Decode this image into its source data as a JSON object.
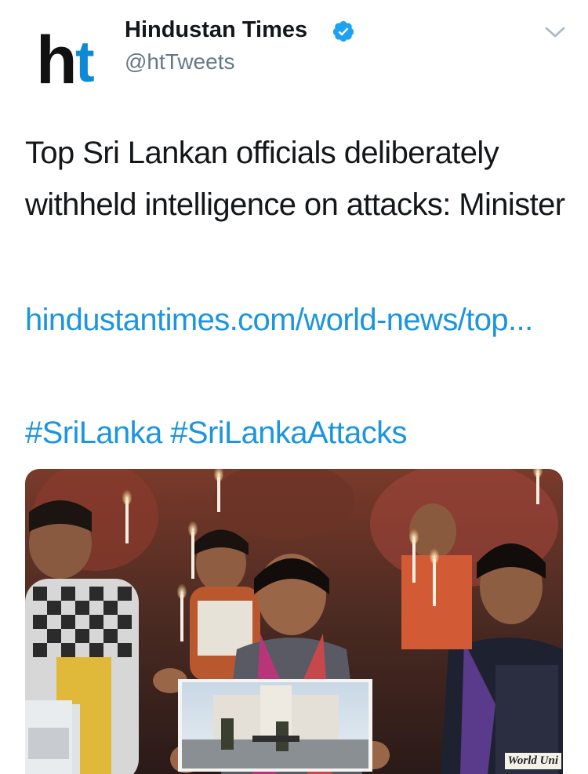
{
  "account": {
    "display_name": "Hindustan Times",
    "handle": "@htTweets",
    "verified": true,
    "avatar_logo": {
      "letter_h": "h",
      "letter_t": "t",
      "h_color": "#111111",
      "t_color": "#0c8ad6"
    }
  },
  "tweet": {
    "text": "Top Sri Lankan officials deliberately withheld intelligence on attacks: Minister",
    "link_text": "hindustantimes.com/world-news/top...",
    "hashtags": [
      "#SriLanka",
      "#SriLankaAttacks"
    ],
    "media": {
      "watermark": "World Uni"
    }
  },
  "icons": {
    "verified": "verified-badge-icon",
    "caret": "chevron-down-icon"
  },
  "colors": {
    "link": "#1b95e0",
    "text": "#14171a",
    "muted": "#657786",
    "verified": "#1da1f2"
  }
}
